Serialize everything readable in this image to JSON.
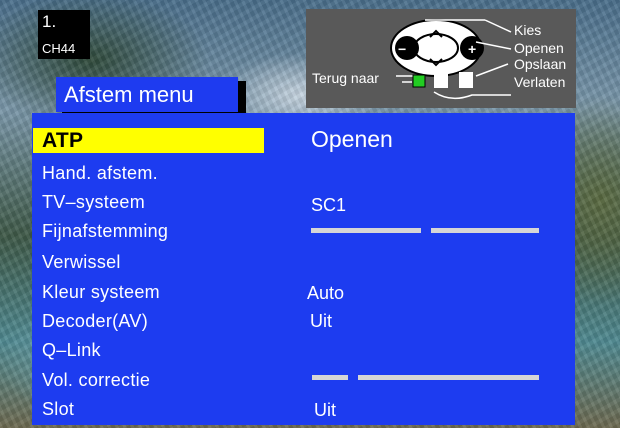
{
  "channel": {
    "number": "1.",
    "name": "CH44"
  },
  "help": {
    "kies": "Kies",
    "openen": "Openen",
    "opslaan": "Opslaan",
    "verlaten": "Verlaten",
    "terug": "Terug naar",
    "minus": "−",
    "plus": "+"
  },
  "menu": {
    "title": "Afstem menu",
    "items": [
      {
        "label": "ATP",
        "value": "Openen"
      },
      {
        "label": "Hand. afstem.",
        "value": ""
      },
      {
        "label": "TV–systeem",
        "value": "SC1"
      },
      {
        "label": "Fijnafstemming",
        "value": ""
      },
      {
        "label": "Verwissel",
        "value": ""
      },
      {
        "label": "Kleur systeem",
        "value": "Auto"
      },
      {
        "label": "Decoder(AV)",
        "value": "Uit"
      },
      {
        "label": "Q–Link",
        "value": ""
      },
      {
        "label": "Vol. correctie",
        "value": ""
      },
      {
        "label": "Slot",
        "value": "Uit"
      }
    ]
  },
  "colors": {
    "menu_blue": "#1d3cf0",
    "highlight_yellow": "#ffff00",
    "help_grey": "#595959",
    "green_button": "#22cc22"
  },
  "icons": [
    "navigation-ring-icon",
    "up-arrow-icon",
    "down-arrow-icon",
    "green-button-icon",
    "white-button-icon"
  ]
}
